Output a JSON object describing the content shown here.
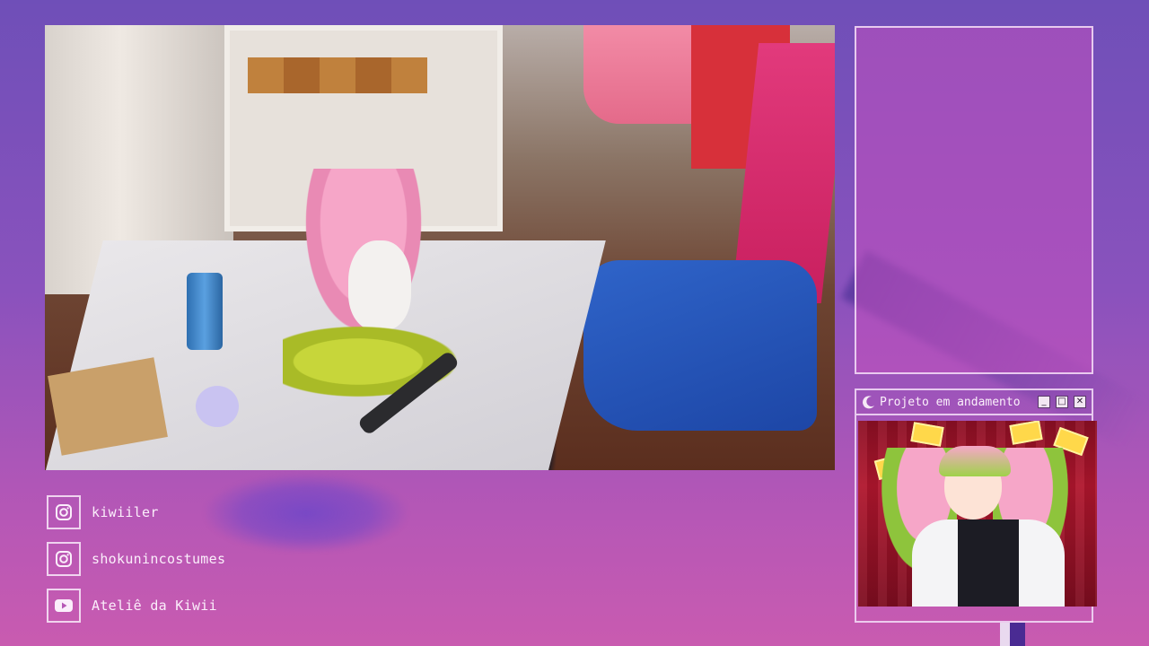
{
  "overlay": {
    "colors": {
      "accent": "#f0d7f5",
      "background_top": "#6f4fb8",
      "background_bottom": "#c95bb0"
    }
  },
  "webcam": {},
  "mini_window": {
    "title": "Projeto em andamento",
    "buttons": {
      "minimize": "_",
      "maximize": "□",
      "close": "✕"
    },
    "icon": "moon-icon"
  },
  "socials": [
    {
      "icon": "instagram-icon",
      "label": "kiwiiler"
    },
    {
      "icon": "instagram-icon",
      "label": "shokunincostumes"
    },
    {
      "icon": "youtube-icon",
      "label": "Ateliê da Kiwii"
    }
  ]
}
